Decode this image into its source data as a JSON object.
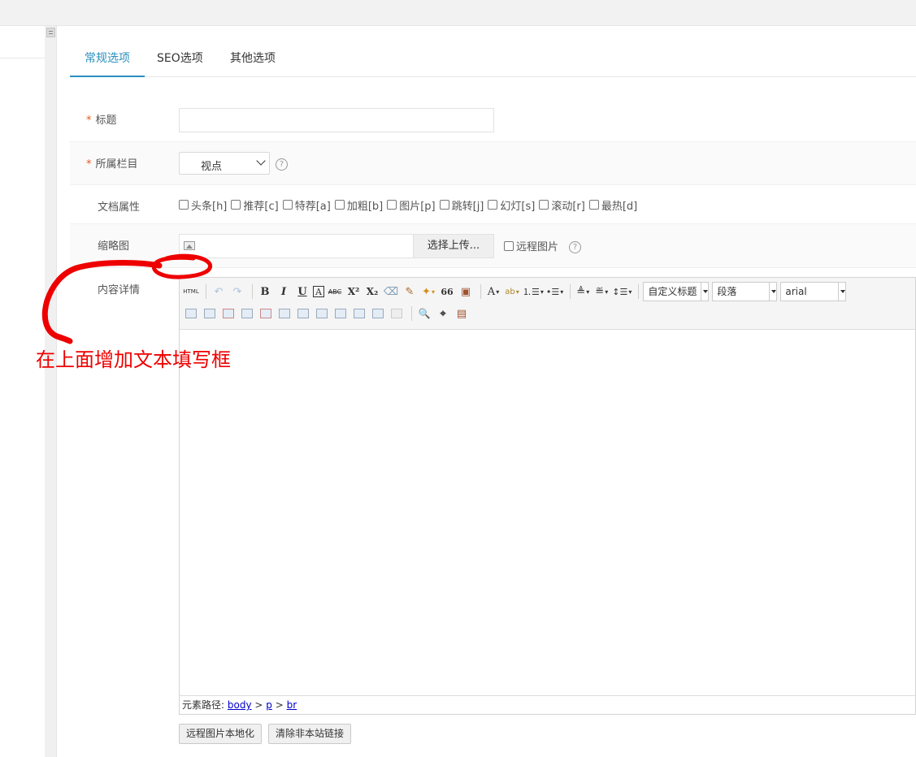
{
  "tabs": [
    {
      "label": "常规选项",
      "active": true
    },
    {
      "label": "SEO选项",
      "active": false
    },
    {
      "label": "其他选项",
      "active": false
    }
  ],
  "form": {
    "required_mark": "*",
    "title_label": "标题",
    "title_value": "",
    "category_label": "所属栏目",
    "category_value": "视点",
    "help_glyph": "?",
    "attr_label": "文档属性",
    "attrs": [
      "头条[h]",
      "推荐[c]",
      "特荐[a]",
      "加粗[b]",
      "图片[p]",
      "跳转[j]",
      "幻灯[s]",
      "滚动[r]",
      "最热[d]"
    ],
    "thumb_label": "缩略图",
    "upload_label": "选择上传...",
    "remote_image_label": "远程图片",
    "content_label": "内容详情"
  },
  "editor": {
    "toolbar_row1": {
      "html": "HTML",
      "undo": "↶",
      "redo": "↷",
      "bold": "B",
      "italic": "I",
      "underline": "U",
      "border_char": "A",
      "strike": "ABC",
      "sup": "X²",
      "sub": "X₂",
      "eraser": "⌫",
      "brush": "✎",
      "magic": "✦",
      "quote": "66",
      "paste": "▣",
      "font_color": "A",
      "highlight": "ab",
      "ordered_list": "⒈☰",
      "unordered_list": "•☰",
      "row_spacing_top": "≜",
      "row_spacing_bottom": "≝",
      "line_height": "↕☰",
      "dropdown_glyph": "▾"
    },
    "combos": {
      "custom_title": "自定义标题",
      "paragraph": "段落",
      "font": "arial"
    },
    "toolbar_row2_search": "🔍",
    "toolbar_row2_binoculars": "⌖",
    "toolbar_row2_paste": "▤",
    "path_label": "元素路径:",
    "path": [
      "body",
      "p",
      "br"
    ],
    "path_sep": ">"
  },
  "buttons": {
    "localize_images": "远程图片本地化",
    "clear_links": "清除非本站链接"
  },
  "annotation": {
    "note": "在上面增加文本填写框",
    "color": "#ee0000"
  },
  "colors": {
    "accent": "#2a8fbd",
    "required": "#e55a20"
  }
}
